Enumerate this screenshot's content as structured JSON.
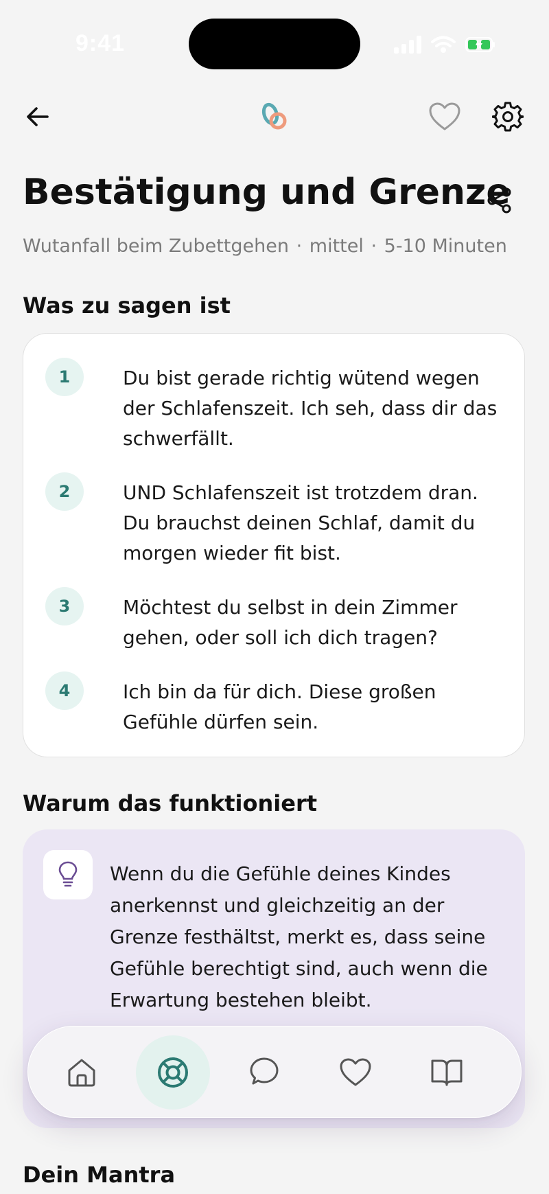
{
  "status_bar": {
    "time": "9:41"
  },
  "header": {
    "back_icon": "arrow-left-icon",
    "logo_icon": "brand-logo",
    "favorite_icon": "heart-icon",
    "settings_icon": "gear-icon"
  },
  "page": {
    "title": "Bestätigung und Grenze",
    "share_icon": "share-icon",
    "subtitle_parts": [
      "Wutanfall beim Zubettgehen",
      "mittel",
      "5-10 Minuten"
    ],
    "subtitle_separator": "·"
  },
  "what_to_say": {
    "heading": "Was zu sagen ist",
    "steps": [
      {
        "number": "1",
        "text": "Du bist gerade richtig wütend wegen der Schlafenszeit. Ich seh, dass dir das schwerfällt."
      },
      {
        "number": "2",
        "text": "UND Schlafenszeit ist trotzdem dran. Du brauchst deinen Schlaf, damit du morgen wieder fit bist."
      },
      {
        "number": "3",
        "text": "Möchtest du selbst in dein Zimmer gehen, oder soll ich dich tragen?"
      },
      {
        "number": "4",
        "text": "Ich bin da für dich. Diese großen Gefühle dürfen sein."
      }
    ]
  },
  "why_it_works": {
    "heading": "Warum das funktioniert",
    "icon": "lightbulb-icon",
    "text": "Wenn du die Gefühle deines Kindes anerkennst und gleichzeitig an der Grenze festhältst, merkt es, dass seine Gefühle berechtigt sind, auch wenn die Erwartung bestehen bleibt."
  },
  "mantra": {
    "heading": "Dein Mantra"
  },
  "tab_bar": {
    "active": "help",
    "tabs": [
      {
        "id": "home",
        "icon": "home-icon"
      },
      {
        "id": "help",
        "icon": "lifebuoy-icon"
      },
      {
        "id": "chat",
        "icon": "chat-bubble-icon"
      },
      {
        "id": "favorites",
        "icon": "heart-icon"
      },
      {
        "id": "library",
        "icon": "book-open-icon"
      }
    ]
  },
  "colors": {
    "accent_teal": "#2b7a72",
    "step_badge_bg": "#e6f4f1",
    "why_card_bg": "#ebe6f4",
    "bulb_purple": "#6a4c93",
    "battery_green": "#34c759"
  }
}
